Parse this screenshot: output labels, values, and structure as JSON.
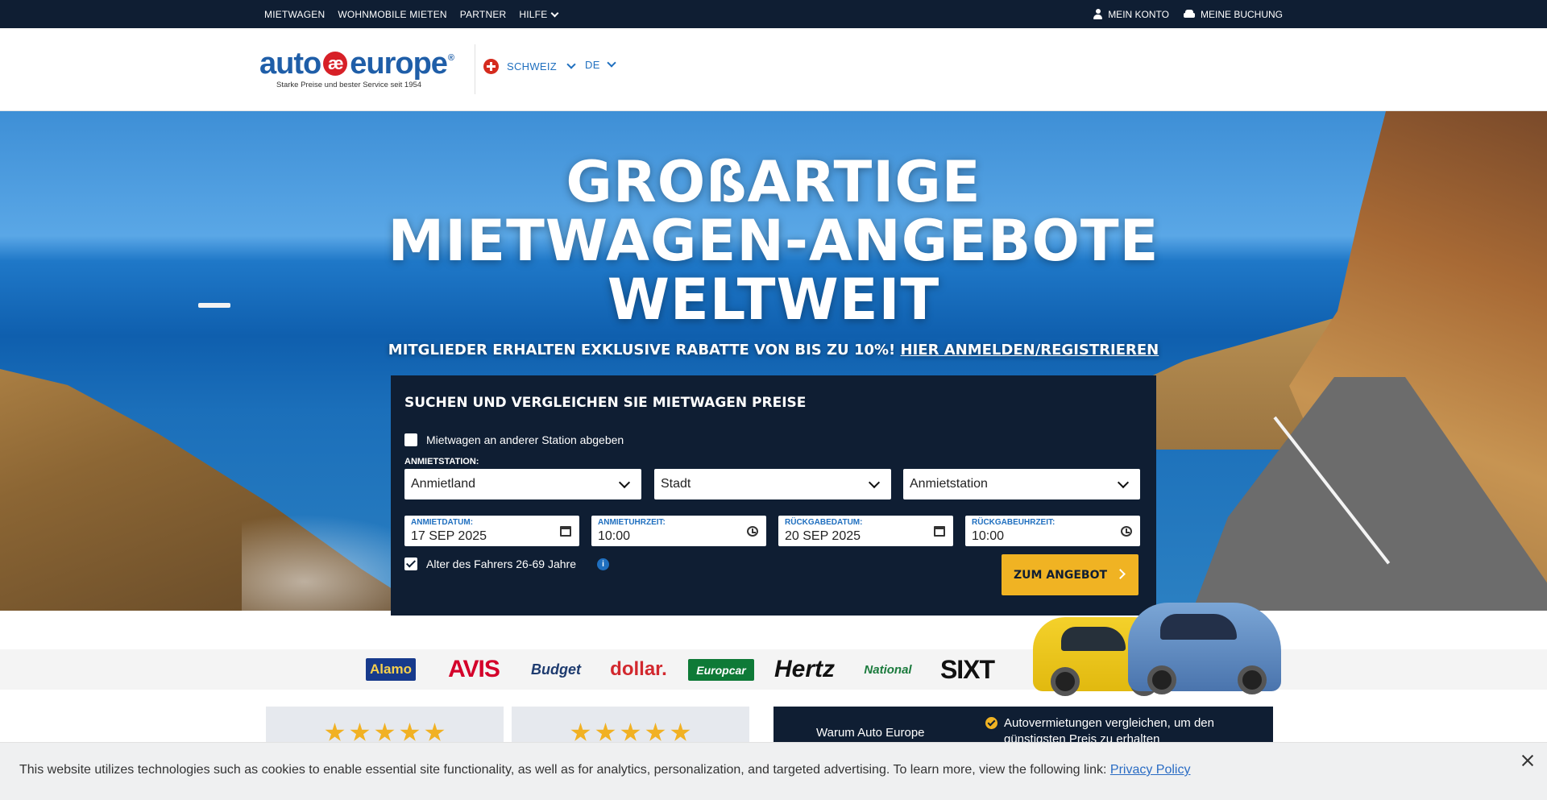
{
  "topbar": {
    "nav": [
      {
        "label": "MIETWAGEN"
      },
      {
        "label": "WOHNMOBILE MIETEN"
      },
      {
        "label": "PARTNER"
      },
      {
        "label": "HILFE"
      }
    ],
    "account": "MEIN KONTO",
    "booking": "MEINE BUCHUNG"
  },
  "header": {
    "logo_left": "auto",
    "logo_mark": "æ",
    "logo_right": "europe",
    "logo_reg": "®",
    "tagline": "Starke Preise und bester Service seit 1954",
    "country": "SCHWEIZ",
    "language": "DE"
  },
  "hero": {
    "title_line1": "GROßARTIGE",
    "title_line2": "MIETWAGEN-ANGEBOTE",
    "title_line3": "WELTWEIT",
    "subtitle": "MITGLIEDER ERHALTEN EXKLUSIVE RABATTE VON BIS ZU 10%!",
    "subtitle_link": "HIER ANMELDEN/REGISTRIEREN"
  },
  "search": {
    "heading": "SUCHEN UND VERGLEICHEN SIE MIETWAGEN PREISE",
    "other_station": {
      "label": "Mietwagen an anderer Station abgeben",
      "checked": false
    },
    "station_label": "ANMIETSTATION:",
    "country_select": "Anmietland",
    "city_select": "Stadt",
    "station_select": "Anmietstation",
    "pickup_date": {
      "label": "ANMIETDATUM:",
      "value": "17 SEP 2025"
    },
    "pickup_time": {
      "label": "ANMIETUHRZEIT:",
      "value": "10:00"
    },
    "return_date": {
      "label": "RÜCKGABEDATUM:",
      "value": "20 SEP 2025"
    },
    "return_time": {
      "label": "RÜCKGABEUHRZEIT:",
      "value": "10:00"
    },
    "driver_age": {
      "label": "Alter des Fahrers 26-69 Jahre",
      "checked": true
    },
    "info_glyph": "i",
    "submit": "ZUM ANGEBOT"
  },
  "brands": [
    "Alamo",
    "AVIS",
    "Budget",
    "dollar.",
    "Europcar",
    "Hertz",
    "National",
    "SIXT"
  ],
  "why": {
    "title": "Warum Auto Europe",
    "point": "Autovermietungen vergleichen, um den günstigsten Preis zu erhalten"
  },
  "cookie": {
    "text": "This website utilizes technologies such as cookies to enable essential site functionality, as well as for analytics, personalization, and targeted advertising. To learn more, view the following link:",
    "link": "Privacy Policy"
  },
  "colors": {
    "navy": "#0f1e33",
    "brand_blue": "#1f6fbf",
    "cta_yellow": "#f0b323",
    "star_gold": "#f1b123"
  },
  "icons": [
    "user-icon",
    "car-icon",
    "chevron-down-icon",
    "swiss-flag-icon",
    "calendar-icon",
    "clock-icon",
    "info-icon",
    "chevron-right-icon",
    "check-icon",
    "star-icon",
    "close-icon"
  ]
}
